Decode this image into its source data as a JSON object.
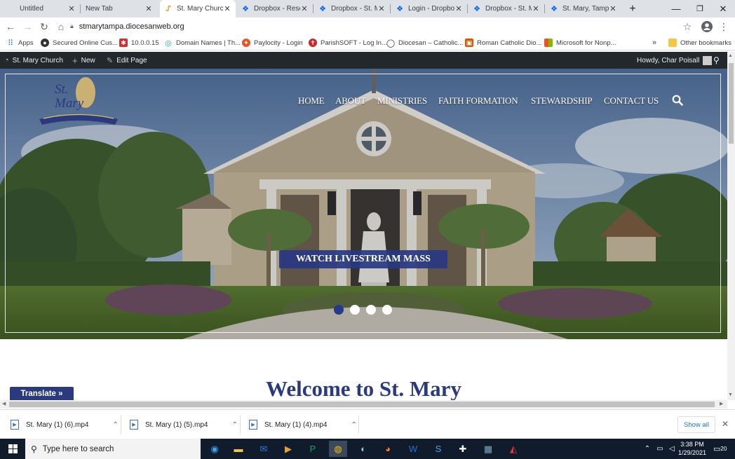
{
  "browser": {
    "tabs": [
      {
        "label": "Untitled",
        "icon": "blank"
      },
      {
        "label": "New Tab",
        "icon": "blank"
      },
      {
        "label": "St. Mary Church",
        "icon": "st-mary-favicon",
        "active": true
      },
      {
        "label": "Dropbox - Reset",
        "icon": "dropbox-icon"
      },
      {
        "label": "Dropbox - St. M",
        "icon": "dropbox-icon"
      },
      {
        "label": "Login - Dropbox",
        "icon": "dropbox-icon"
      },
      {
        "label": "Dropbox - St. M",
        "icon": "dropbox-icon"
      },
      {
        "label": "St. Mary, Tampa",
        "icon": "dropbox-icon"
      }
    ],
    "url": "stmarytampa.diocesanweb.org",
    "bookmarks": [
      {
        "label": "Apps",
        "icon": "apps-grid-icon"
      },
      {
        "label": "Secured Online Cus...",
        "icon": "bank-icon"
      },
      {
        "label": "10.0.0.15",
        "icon": "network-icon"
      },
      {
        "label": "Domain Names | Th...",
        "icon": "domain-icon"
      },
      {
        "label": "Paylocity - Login",
        "icon": "paylocity-icon"
      },
      {
        "label": "ParishSOFT - Log In...",
        "icon": "parishsoft-icon"
      },
      {
        "label": "Diocesan – Catholic...",
        "icon": "diocesan-icon"
      },
      {
        "label": "Roman Catholic Dio...",
        "icon": "roman-catholic-icon"
      },
      {
        "label": "Microsoft for Nonp...",
        "icon": "microsoft-icon"
      }
    ],
    "bookmarks_overflow": "»",
    "other_bookmarks": "Other bookmarks"
  },
  "adminbar": {
    "site_name": "St. Mary Church",
    "new_label": "New",
    "edit_label": "Edit Page",
    "howdy": "Howdy, Char Poisall"
  },
  "site": {
    "logo_text": "St. Mary",
    "nav": [
      "HOME",
      "ABOUT",
      "MINISTRIES",
      "FAITH FORMATION",
      "STEWARDSHIP",
      "CONTACT US"
    ],
    "cta": "WATCH LIVESTREAM MASS",
    "slider_dots": 4,
    "slider_active": 0,
    "welcome": "Welcome to St. Mary",
    "translate": "Translate »"
  },
  "downloads": {
    "items": [
      "St. Mary (1) (6).mp4",
      "St. Mary (1) (5).mp4",
      "St. Mary (1) (4).mp4"
    ],
    "show_all": "Show all"
  },
  "taskbar": {
    "search_placeholder": "Type here to search",
    "time": "3:38 PM",
    "date": "1/29/2021",
    "notification_count": "20"
  },
  "colors": {
    "brand_navy": "#2b3a7e",
    "adminbar_bg": "#23282d",
    "taskbar_bg": "#101c2c"
  }
}
